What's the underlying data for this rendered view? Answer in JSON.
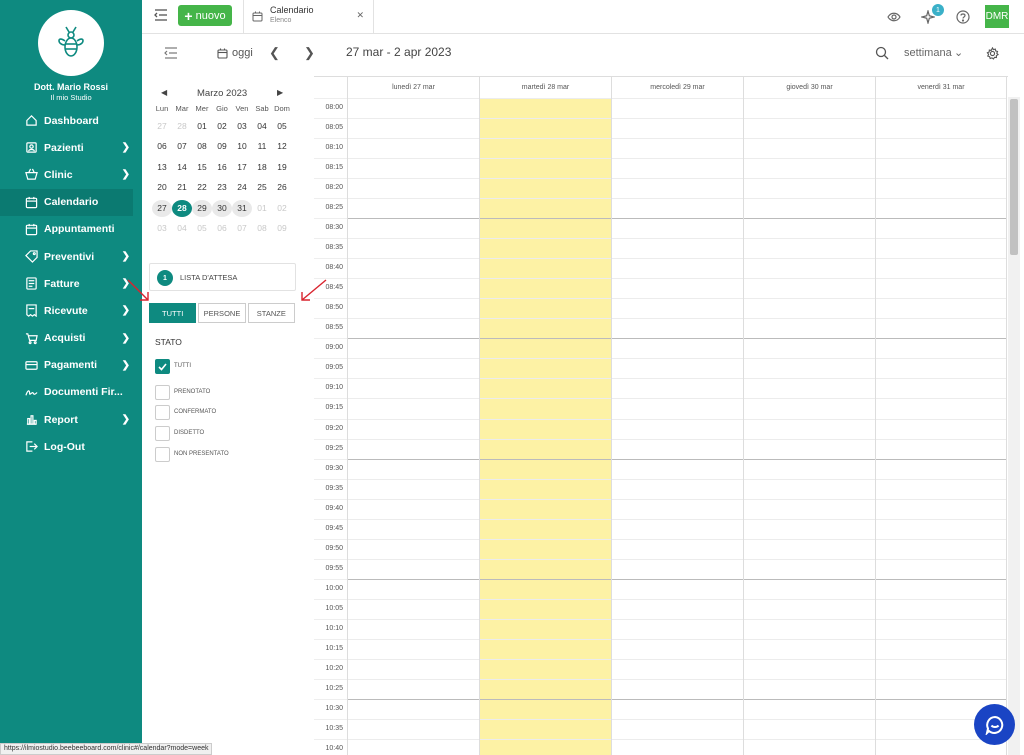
{
  "sidebar": {
    "user_name": "Dott. Mario Rossi",
    "user_studio": "Il mio Studio",
    "items": [
      {
        "label": "Dashboard",
        "icon": "home-icon",
        "chevron": false
      },
      {
        "label": "Pazienti",
        "icon": "patients-icon",
        "chevron": true
      },
      {
        "label": "Clinic",
        "icon": "basket-icon",
        "chevron": true
      },
      {
        "label": "Calendario",
        "icon": "calendar-icon",
        "chevron": false,
        "active": true
      },
      {
        "label": "Appuntamenti",
        "icon": "calendar-icon",
        "chevron": false
      },
      {
        "label": "Preventivi",
        "icon": "tag-icon",
        "chevron": true
      },
      {
        "label": "Fatture",
        "icon": "invoice-icon",
        "chevron": true
      },
      {
        "label": "Ricevute",
        "icon": "receipt-icon",
        "chevron": true
      },
      {
        "label": "Acquisti",
        "icon": "cart-icon",
        "chevron": true
      },
      {
        "label": "Pagamenti",
        "icon": "card-icon",
        "chevron": true
      },
      {
        "label": "Documenti Fir...",
        "icon": "signature-icon",
        "chevron": false
      },
      {
        "label": "Report",
        "icon": "report-icon",
        "chevron": true
      },
      {
        "label": "Log-Out",
        "icon": "logout-icon",
        "chevron": false
      }
    ]
  },
  "topbar": {
    "new_label": "nuovo",
    "tab_title": "Calendario",
    "tab_subtitle": "Elenco",
    "notification_count": "1",
    "avatar_initials": "DMR"
  },
  "toolbar": {
    "today_label": "oggi",
    "date_range": "27 mar - 2 apr 2023",
    "view_label": "settimana"
  },
  "mini_calendar": {
    "title": "Marzo 2023",
    "days_of_week": [
      "Lun",
      "Mar",
      "Mer",
      "Gio",
      "Ven",
      "Sab",
      "Dom"
    ],
    "weeks": [
      [
        {
          "d": "27",
          "o": true
        },
        {
          "d": "28",
          "o": true
        },
        {
          "d": "01"
        },
        {
          "d": "02"
        },
        {
          "d": "03"
        },
        {
          "d": "04"
        },
        {
          "d": "05"
        }
      ],
      [
        {
          "d": "06"
        },
        {
          "d": "07"
        },
        {
          "d": "08"
        },
        {
          "d": "09"
        },
        {
          "d": "10"
        },
        {
          "d": "11"
        },
        {
          "d": "12"
        }
      ],
      [
        {
          "d": "13"
        },
        {
          "d": "14"
        },
        {
          "d": "15"
        },
        {
          "d": "16"
        },
        {
          "d": "17"
        },
        {
          "d": "18"
        },
        {
          "d": "19"
        }
      ],
      [
        {
          "d": "20"
        },
        {
          "d": "21"
        },
        {
          "d": "22"
        },
        {
          "d": "23"
        },
        {
          "d": "24"
        },
        {
          "d": "25"
        },
        {
          "d": "26"
        }
      ],
      [
        {
          "d": "27",
          "w": true
        },
        {
          "d": "28",
          "s": true
        },
        {
          "d": "29",
          "w": true
        },
        {
          "d": "30",
          "w": true
        },
        {
          "d": "31",
          "w": true
        },
        {
          "d": "01",
          "o": true
        },
        {
          "d": "02",
          "o": true
        }
      ],
      [
        {
          "d": "03",
          "o": true
        },
        {
          "d": "04",
          "o": true
        },
        {
          "d": "05",
          "o": true
        },
        {
          "d": "06",
          "o": true
        },
        {
          "d": "07",
          "o": true
        },
        {
          "d": "08",
          "o": true
        },
        {
          "d": "09",
          "o": true
        }
      ]
    ]
  },
  "waitlist": {
    "count": "1",
    "label": "LISTA D'ATTESA"
  },
  "filters": {
    "all": "TUTTI",
    "people": "PERSONE",
    "rooms": "STANZE"
  },
  "stato": {
    "title": "STATO",
    "options": [
      {
        "label": "TUTTI",
        "checked": true
      },
      {
        "label": "PRENOTATO",
        "checked": false
      },
      {
        "label": "CONFERMATO",
        "checked": false
      },
      {
        "label": "DISDETTO",
        "checked": false
      },
      {
        "label": "NON PRESENTATO",
        "checked": false
      }
    ]
  },
  "calendar": {
    "days": [
      "lunedì 27 mar",
      "martedì 28 mar",
      "mercoledì 29 mar",
      "giovedì 30 mar",
      "venerdì 31 mar"
    ],
    "today_index": 1,
    "times": [
      "08:00",
      "08:05",
      "08:10",
      "08:15",
      "08:20",
      "08:25",
      "08:30",
      "08:35",
      "08:40",
      "08:45",
      "08:50",
      "08:55",
      "09:00",
      "09:05",
      "09:10",
      "09:15",
      "09:20",
      "09:25",
      "09:30",
      "09:35",
      "09:40",
      "09:45",
      "09:50",
      "09:55",
      "10:00",
      "10:05",
      "10:10",
      "10:15",
      "10:20",
      "10:25",
      "10:30",
      "10:35",
      "10:40"
    ]
  },
  "status_url": "https://ilmiostudio.beebeeboard.com/clinic#/calendar?mode=week",
  "colors": {
    "primary": "#0e8a80",
    "new_button": "#45b549",
    "today_column": "#fdf2a5",
    "chat": "#1a44c4"
  }
}
